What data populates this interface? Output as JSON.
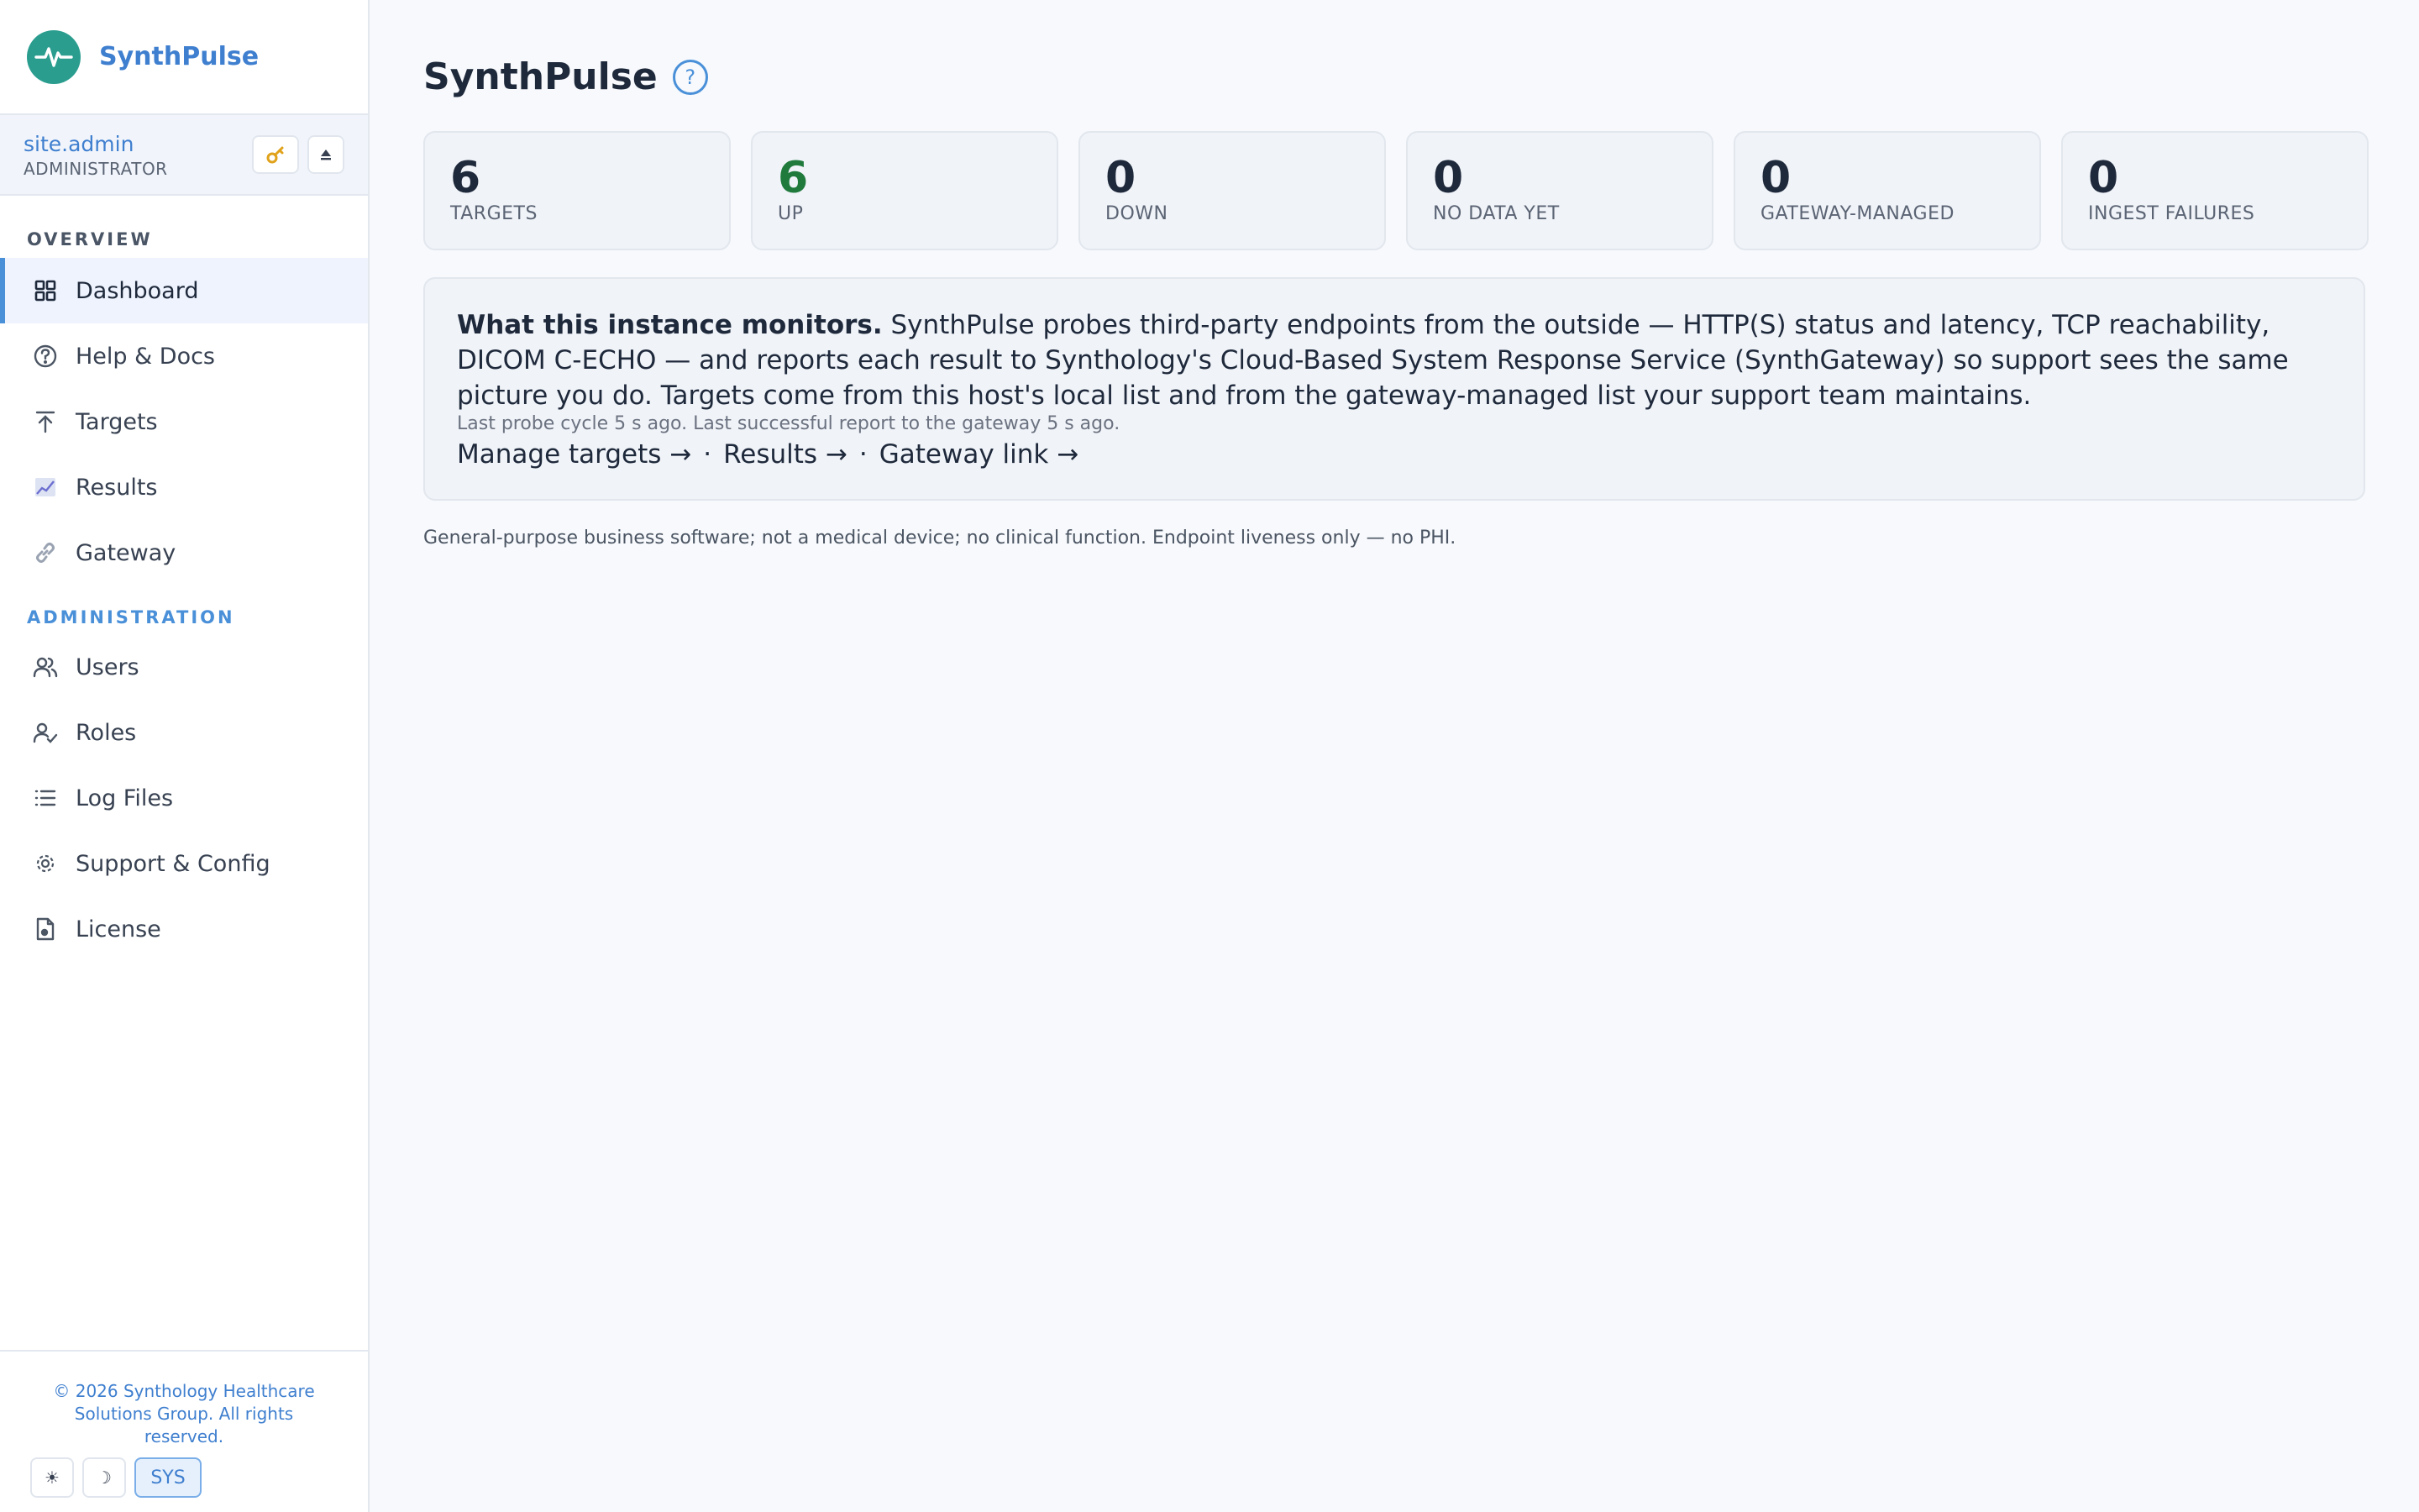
{
  "brand": {
    "name": "SynthPulse",
    "logo_icon": "pulse-icon"
  },
  "user": {
    "name": "site.admin",
    "role": "ADMINISTRATOR",
    "key_icon": "key-icon",
    "eject_icon": "eject-icon"
  },
  "nav": {
    "overview_label": "OVERVIEW",
    "admin_label": "ADMINISTRATION",
    "overview_items": [
      {
        "label": "Dashboard",
        "icon": "grid-icon",
        "active": true
      },
      {
        "label": "Help & Docs",
        "icon": "help-circle-icon"
      },
      {
        "label": "Targets",
        "icon": "arrow-up-icon"
      },
      {
        "label": "Results",
        "icon": "chart-icon"
      },
      {
        "label": "Gateway",
        "icon": "link-icon"
      }
    ],
    "admin_items": [
      {
        "label": "Users",
        "icon": "users-icon"
      },
      {
        "label": "Roles",
        "icon": "user-check-icon"
      },
      {
        "label": "Log Files",
        "icon": "list-icon"
      },
      {
        "label": "Support & Config",
        "icon": "gear-icon"
      },
      {
        "label": "License",
        "icon": "file-icon"
      }
    ]
  },
  "footer": {
    "copyright": "© 2026 Synthology Healthcare Solutions Group. All rights reserved.",
    "theme_light": "☀",
    "theme_dark": "☽",
    "theme_sys": "SYS"
  },
  "page": {
    "title": "SynthPulse",
    "help_icon": "?"
  },
  "stats": [
    {
      "value": "6",
      "label": "TARGETS"
    },
    {
      "value": "6",
      "label": "UP"
    },
    {
      "value": "0",
      "label": "DOWN"
    },
    {
      "value": "0",
      "label": "NO DATA YET"
    },
    {
      "value": "0",
      "label": "GATEWAY-MANAGED"
    },
    {
      "value": "0",
      "label": "INGEST FAILURES"
    }
  ],
  "info": {
    "heading": "What this instance monitors.",
    "body": " SynthPulse probes third-party endpoints from the outside — HTTP(S) status and latency, TCP reachability, DICOM C-ECHO — and reports each result to Synthology's Cloud-Based System Response Service (SynthGateway) so support sees the same picture you do. Targets come from this host's local list and from the gateway-managed list your support team maintains.",
    "status": "Last probe cycle 5 s ago. Last successful report to the gateway 5 s ago.",
    "links": [
      "Manage targets →",
      "Results →",
      "Gateway link →"
    ],
    "separator": "·"
  },
  "colors": {
    "accent": "#4a90d9",
    "brand": "#2a9d8f",
    "up": "#1f7a3c"
  },
  "disclaimer": "General-purpose business software; not a medical device; no clinical function. Endpoint liveness only — no PHI."
}
